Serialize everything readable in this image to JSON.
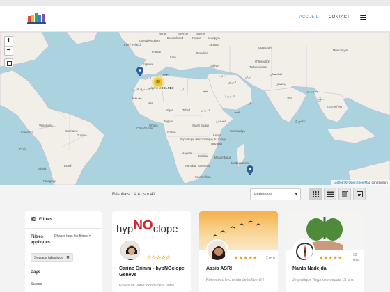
{
  "header": {
    "logo": "logo",
    "nav": [
      {
        "label": "ACCUEIL",
        "active": true
      },
      {
        "label": "CONTACT",
        "active": false
      }
    ],
    "menu_icon": "hamburger-icon"
  },
  "map": {
    "zoom_in": "+",
    "zoom_out": "−",
    "cluster_count": "39",
    "labels": {
      "deutschland": "Deutschland",
      "polska": "Polska",
      "ukraina": "Україна",
      "kazakhstan": "Казахстан",
      "mongolia": "Монгол улс",
      "espana": "España",
      "italia": "Italia",
      "turkiye": "Türkiye",
      "romania": "România",
      "turkmenistan": "Türkmenistan",
      "uzbekistan": "O‘zbekiston",
      "tunisie": "تونس",
      "iran": "ایران",
      "afghanistan": "افغانستان",
      "pakistan": "پاکستان",
      "algerie": "Algérie ⵍⵣⵣⴰⵢⴻⵔ",
      "maroc": "المغرب",
      "libya": "ليبيا",
      "egypt": "مصر",
      "saudi": "السعودية",
      "india": "भारत",
      "mali": "Mali",
      "niger": "Niger",
      "tchad": "Tchad",
      "sudan": "السودان",
      "yemen": "اليمن",
      "oman": "عمان",
      "nigeria": "Nigeria",
      "ethiopia": "ኢትዮጵያ",
      "somalia": "Soomaaliya",
      "south_sudan": "South Sudan",
      "rdc": "République démocratique du Congo",
      "kenya": "Kenya",
      "tanzania": "Tanzania",
      "angola": "Angola",
      "namibia": "Namibia",
      "botswana": "Botswana",
      "south_africa": "South Africa",
      "madagasikara": "Madagasikara",
      "colombia": "Colombia",
      "peru": "Perú",
      "brasil": "Brasil",
      "bolivia": "Bolivia",
      "paraguay": "Paraguay",
      "venezuela": "Venezuela",
      "suriname": "Suriname",
      "guyane": "Guyane",
      "thailand": "ประเทศไทย",
      "sri_lanka": "ශ්‍රී ලංකාව",
      "bangladesh": "বাংলাদেশ",
      "myanmar": "မြန်မာ",
      "mocambique": "Moçambique",
      "zambia": "Zambia",
      "gabon": "Gabon",
      "ghana": "Ghana",
      "cote_ivoire": "Côte d'Ivoire",
      "mauritanie": "موريتانيا",
      "sahara": "الصحراء الغربية",
      "france": "France",
      "sverige": "Sverige",
      "norge": "Norge",
      "suomi": "Suomi",
      "belarus": "Беларусь",
      "uk": "United Kingdom",
      "eire": "Éire / Ireland",
      "iraq": "العراق",
      "syria": "سوريا"
    },
    "attribution_leaflet": "Leaflet",
    "attribution_osm": "OpenStreetMap",
    "attribution_rest": "contributors"
  },
  "results": {
    "count_text": "Résultats 1 à 41 sur 41",
    "sort_value": "Pertinence",
    "view_icons": [
      "grid-view-icon",
      "list-view-icon",
      "map-view-icon",
      "article-view-icon"
    ]
  },
  "filters": {
    "title": "Filtres",
    "applied_label": "Filtres appliqués",
    "clear_label": "Effacer tous les filtres",
    "tag": "Sevrage tabagique",
    "country_label": "Pays",
    "country_option": "Suisse"
  },
  "cards": [
    {
      "logo_text_1": "hyp",
      "logo_text_2": "NO",
      "logo_text_3": "clope",
      "name": "Carine Grimm - hypNOclope Genève",
      "desc": "Faites de votre inconscient votre",
      "rating": 0,
      "avis": ""
    },
    {
      "name": "Assia ASRI",
      "desc": "Retrouvez le chemin de la liberté !",
      "rating": 5,
      "avis": "2 Avis"
    },
    {
      "name": "Nanta Nadejda",
      "desc": "Je pratique l'hypnose depuis 13 ans",
      "rating": 5,
      "avis": "33 Avis"
    }
  ],
  "colors": {
    "accent": "#3a94d8",
    "star": "#f0a31d",
    "marker": "#2a5e9c",
    "cluster": "#f0c20c",
    "land": "#f2efe9",
    "water": "#aad3df"
  }
}
